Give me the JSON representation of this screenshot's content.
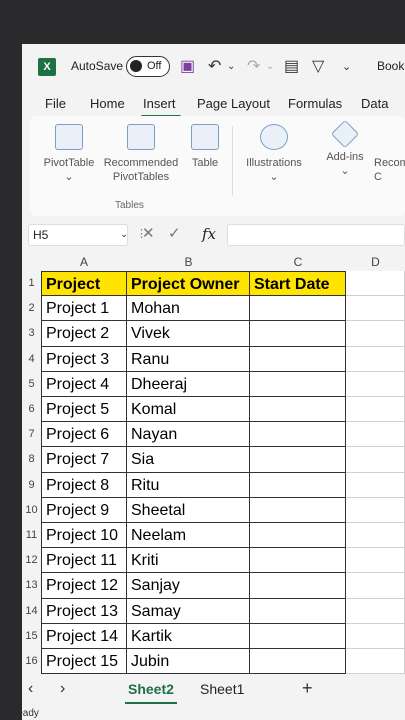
{
  "titlebar": {
    "autosave_label": "AutoSave",
    "toggle_state": "Off",
    "book_label": "Book"
  },
  "menu": [
    "File",
    "Home",
    "Insert",
    "Page Layout",
    "Formulas",
    "Data"
  ],
  "ribbon": {
    "buttons": [
      "PivotTable",
      "Recommended PivotTables",
      "Table",
      "Illustrations",
      "Add-ins",
      "Recom C"
    ],
    "group_label": "Tables"
  },
  "formula_bar": {
    "name_box": "H5",
    "fx_label": "fx",
    "value": ""
  },
  "columns": [
    "A",
    "B",
    "C",
    "D"
  ],
  "rows": [
    {
      "num": "1",
      "a": "Project",
      "b": "Project Owner",
      "c": "Start Date"
    },
    {
      "num": "2",
      "a": "Project 1",
      "b": "Mohan",
      "c": ""
    },
    {
      "num": "3",
      "a": "Project 2",
      "b": "Vivek",
      "c": ""
    },
    {
      "num": "4",
      "a": "Project 3",
      "b": "Ranu",
      "c": ""
    },
    {
      "num": "5",
      "a": "Project 4",
      "b": "Dheeraj",
      "c": ""
    },
    {
      "num": "6",
      "a": "Project 5",
      "b": "Komal",
      "c": ""
    },
    {
      "num": "7",
      "a": "Project 6",
      "b": "Nayan",
      "c": ""
    },
    {
      "num": "8",
      "a": "Project 7",
      "b": "Sia",
      "c": ""
    },
    {
      "num": "9",
      "a": "Project 8",
      "b": "Ritu",
      "c": ""
    },
    {
      "num": "10",
      "a": "Project 9",
      "b": "Sheetal",
      "c": ""
    },
    {
      "num": "11",
      "a": "Project 10",
      "b": "Neelam",
      "c": ""
    },
    {
      "num": "12",
      "a": "Project 11",
      "b": "Kriti",
      "c": ""
    },
    {
      "num": "13",
      "a": "Project 12",
      "b": "Sanjay",
      "c": ""
    },
    {
      "num": "14",
      "a": "Project 13",
      "b": "Samay",
      "c": ""
    },
    {
      "num": "15",
      "a": "Project 14",
      "b": "Kartik",
      "c": ""
    },
    {
      "num": "16",
      "a": "Project 15",
      "b": "Jubin",
      "c": ""
    }
  ],
  "sheets": {
    "active": "Sheet2",
    "other": "Sheet1",
    "add": "+"
  },
  "status": "Ready",
  "colors": {
    "header_fill": "#ffe400",
    "excel_green": "#1e7145"
  }
}
